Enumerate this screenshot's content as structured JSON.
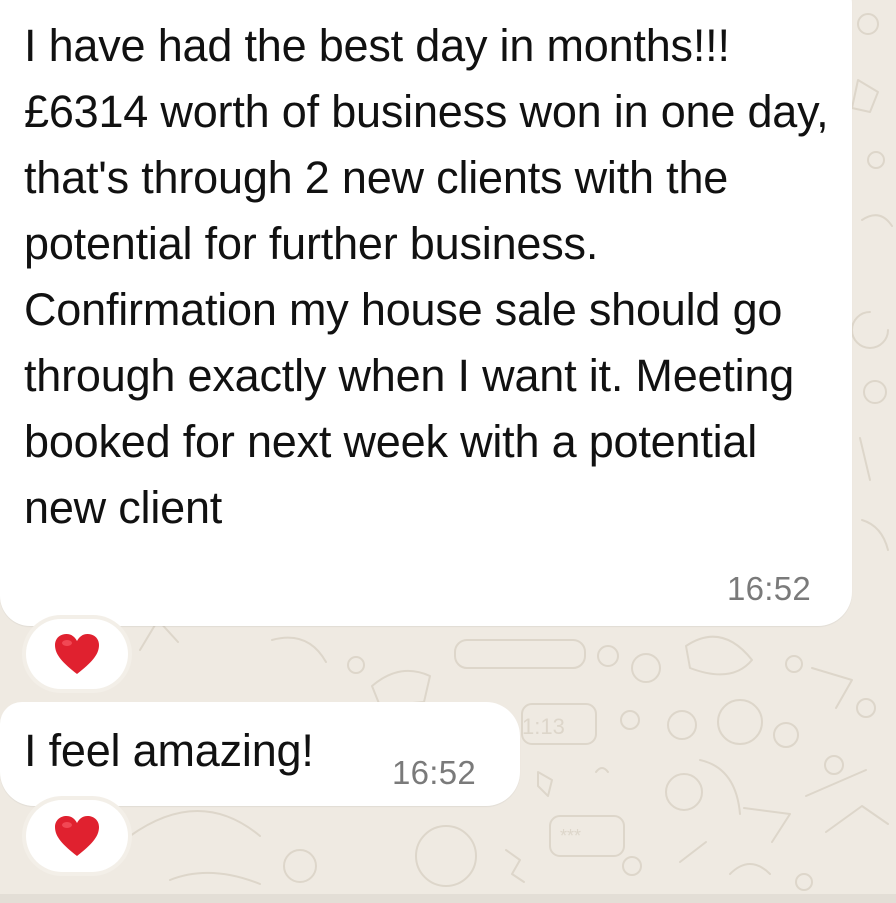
{
  "messages": [
    {
      "text": "I have had the best day in months!!! £6314 worth of business won in one day, that's through 2 new clients with the potential for further business. Confirmation my house sale should go through exactly when I want it. Meeting booked for next week with a potential new client",
      "time": "16:52",
      "reaction": "heart-icon"
    },
    {
      "text": "I feel amazing!",
      "time": "16:52",
      "reaction": "heart-icon"
    }
  ],
  "colors": {
    "background": "#efeae2",
    "bubble": "#ffffff",
    "text": "#111111",
    "timestamp": "#7a7a7a",
    "heart": "#e0212f"
  }
}
